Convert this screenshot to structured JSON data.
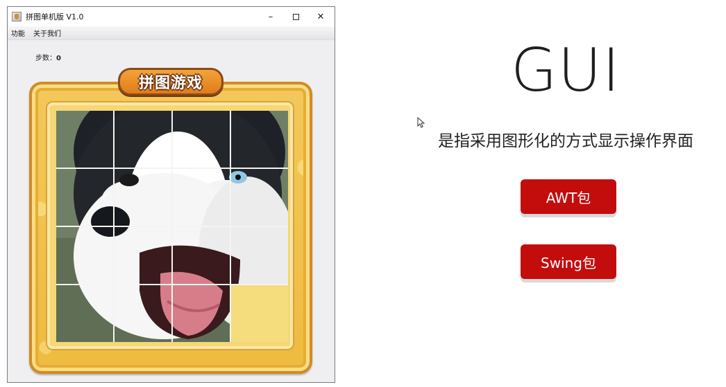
{
  "window": {
    "title": "拼图单机版 V1.0",
    "controls": {
      "minimize": "–",
      "close": "✕"
    }
  },
  "menubar": {
    "items": [
      "功能",
      "关于我们"
    ]
  },
  "game": {
    "steps_label": "步数：",
    "steps_value": "0",
    "logo_text": "拼图游戏",
    "grid_rows": 4,
    "grid_cols": 4,
    "empty_tile": {
      "row": 3,
      "col": 3
    }
  },
  "slide": {
    "title": "GUI",
    "description": "是指采用图形化的方式显示操作界面",
    "buttons": [
      "AWT包",
      "Swing包"
    ]
  },
  "colors": {
    "button_red": "#c30d0d",
    "frame_gold": "#eebb3f",
    "frame_border": "#d08c22"
  }
}
